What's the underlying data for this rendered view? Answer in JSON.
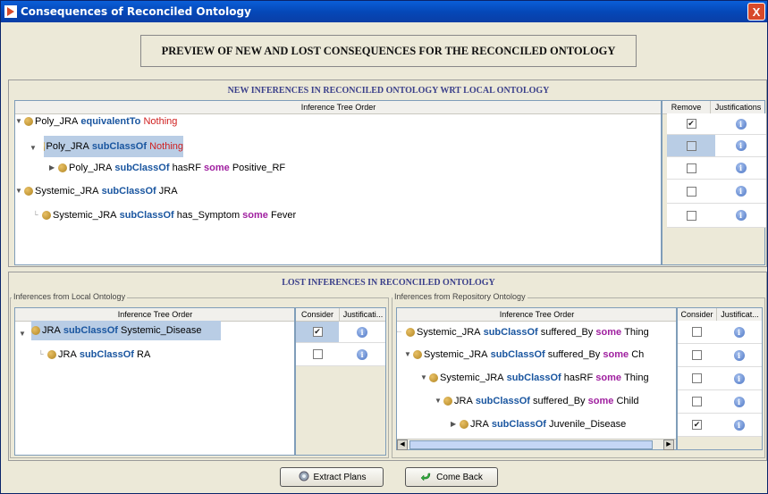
{
  "window": {
    "title": "Consequences of Reconciled Ontology",
    "close_label": "X"
  },
  "header": {
    "preview_title": "PREVIEW OF NEW AND LOST CONSEQUENCES FOR THE RECONCILED ONTOLOGY"
  },
  "new_inferences": {
    "title": "NEW INFERENCES IN RECONCILED ONTOLOGY WRT LOCAL ONTOLOGY",
    "columns": [
      "Inference Tree Order",
      "Remove",
      "Justifications"
    ],
    "rows": [
      {
        "subject": "Poly_JRA",
        "keyword": "equivalentTo",
        "object": "Nothing",
        "remove": true
      },
      {
        "subject": "Poly_JRA",
        "keyword": "subClassOf",
        "object": "Nothing",
        "remove": false
      },
      {
        "subject": "Poly_JRA",
        "keyword": "subClassOf",
        "object": "hasRF",
        "some": "some",
        "filler": "Positive_RF",
        "remove": false
      },
      {
        "subject": "Systemic_JRA",
        "keyword": "subClassOf",
        "object": "JRA",
        "remove": false
      },
      {
        "subject": "Systemic_JRA",
        "keyword": "subClassOf",
        "object": "has_Symptom",
        "some": "some",
        "filler": "Fever",
        "remove": false
      }
    ]
  },
  "lost_inferences": {
    "title": "LOST INFERENCES IN RECONCILED ONTOLOGY",
    "local": {
      "group_label": "Inferences from Local Ontology",
      "columns": [
        "Inference Tree Order",
        "Consider",
        "Justificati..."
      ],
      "rows": [
        {
          "subject": "JRA",
          "keyword": "subClassOf",
          "object": "Systemic_Disease",
          "consider": true
        },
        {
          "subject": "JRA",
          "keyword": "subClassOf",
          "object": "RA",
          "consider": false
        }
      ]
    },
    "repository": {
      "group_label": "Inferences from Repository Ontology",
      "columns": [
        "Inference Tree Order",
        "Consider",
        "Justificat..."
      ],
      "rows": [
        {
          "subject": "Systemic_JRA",
          "keyword": "subClassOf",
          "object": "suffered_By",
          "some": "some",
          "filler": "Thing",
          "consider": false
        },
        {
          "subject": "Systemic_JRA",
          "keyword": "subClassOf",
          "object": "suffered_By",
          "some": "some",
          "filler": "Ch",
          "consider": false
        },
        {
          "subject": "Systemic_JRA",
          "keyword": "subClassOf",
          "object": "hasRF",
          "some": "some",
          "filler": "Thing",
          "consider": false
        },
        {
          "subject": "JRA",
          "keyword": "subClassOf",
          "object": "suffered_By",
          "some": "some",
          "filler": "Child",
          "consider": false
        },
        {
          "subject": "JRA",
          "keyword": "subClassOf",
          "object": "Juvenile_Disease",
          "consider": true
        }
      ]
    }
  },
  "buttons": {
    "extract": "Extract Plans",
    "back": "Come Back"
  },
  "icons": {
    "info": "info-icon",
    "bullet": "class-bullet-icon",
    "extract": "gear-icon",
    "back": "back-arrow-icon"
  },
  "colors": {
    "keyword": "#1a56a0",
    "some": "#a020a0",
    "nothing": "#d02020",
    "selected_row": "#b9cde5"
  }
}
